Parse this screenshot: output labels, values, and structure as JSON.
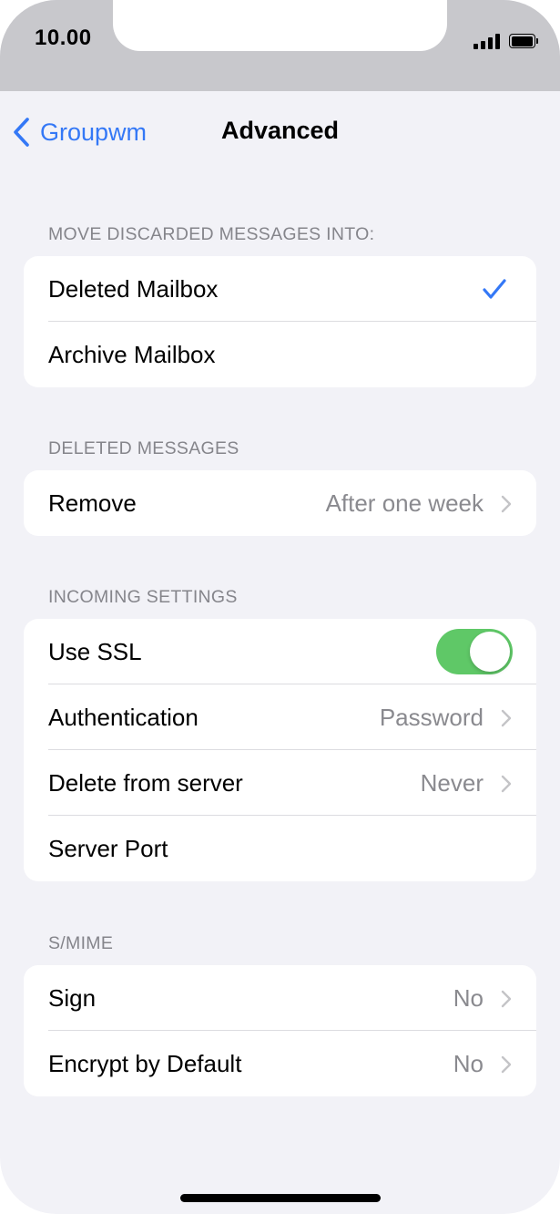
{
  "status_bar": {
    "time": "10.00"
  },
  "nav": {
    "back_label": "Groupwm",
    "title": "Advanced"
  },
  "sections": {
    "discarded": {
      "header": "MOVE DISCARDED MESSAGES INTO:",
      "options": [
        "Deleted Mailbox",
        "Archive Mailbox"
      ],
      "selected": "Deleted Mailbox"
    },
    "deleted": {
      "header": "DELETED MESSAGES",
      "remove_label": "Remove",
      "remove_value": "After one week"
    },
    "incoming": {
      "header": "INCOMING SETTINGS",
      "ssl_label": "Use SSL",
      "ssl_on": true,
      "auth_label": "Authentication",
      "auth_value": "Password",
      "delete_label": "Delete from server",
      "delete_value": "Never",
      "port_label": "Server Port"
    },
    "smime": {
      "header": "S/MIME",
      "sign_label": "Sign",
      "sign_value": "No",
      "encrypt_label": "Encrypt by Default",
      "encrypt_value": "No"
    }
  },
  "colors": {
    "accent": "#3478f6",
    "toggle_on": "#5fc867",
    "background": "#f2f2f7",
    "secondary_text": "#8a8a8f"
  },
  "icons": {
    "back": "chevron-left-icon",
    "checkmark": "checkmark-icon",
    "disclosure": "chevron-right-icon",
    "signal": "cellular-signal-icon",
    "battery": "battery-icon"
  }
}
